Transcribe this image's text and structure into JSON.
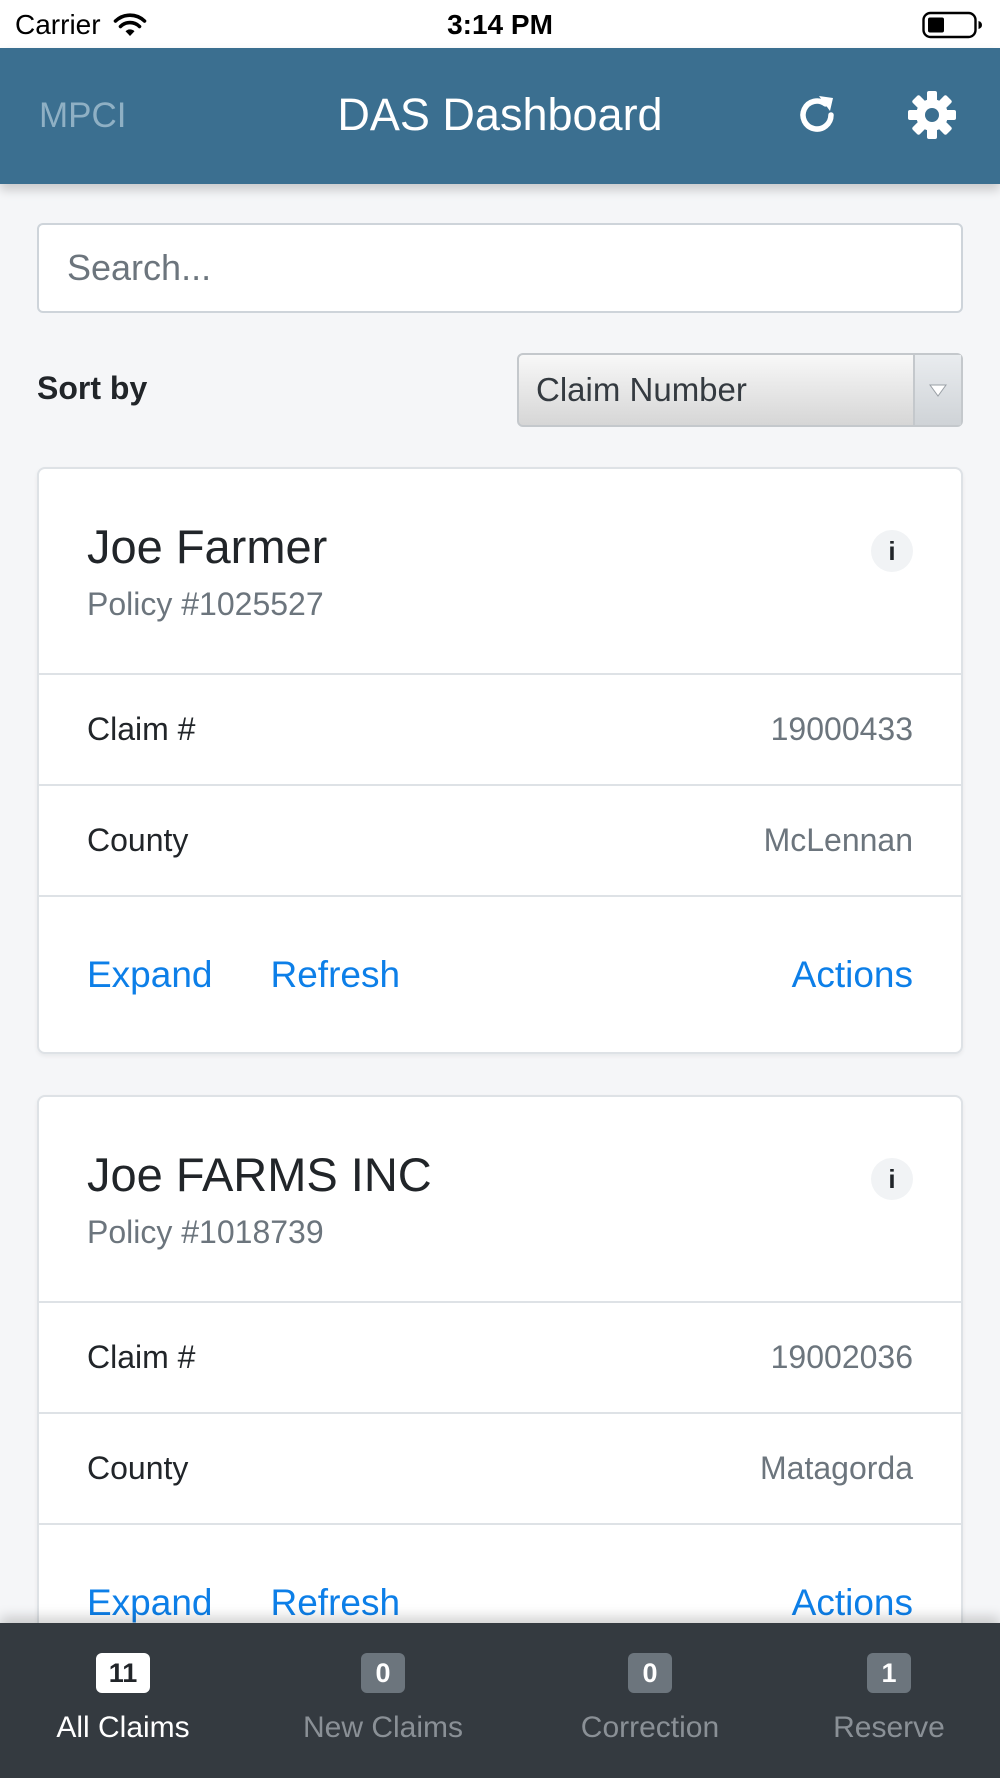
{
  "status_bar": {
    "carrier": "Carrier",
    "time": "3:14 PM"
  },
  "header": {
    "left_label": "MPCI",
    "title": "DAS Dashboard",
    "refresh_icon": "refresh-icon",
    "settings_icon": "gear-icon"
  },
  "search": {
    "placeholder": "Search...",
    "value": ""
  },
  "sort": {
    "label": "Sort by",
    "selected": "Claim Number"
  },
  "claims": [
    {
      "name": "Joe Farmer",
      "policy": "Policy #1025527",
      "claim_label": "Claim #",
      "claim_number": "19000433",
      "county_label": "County",
      "county": "McLennan",
      "expand": "Expand",
      "refresh": "Refresh",
      "actions": "Actions"
    },
    {
      "name": "Joe FARMS INC",
      "policy": "Policy #1018739",
      "claim_label": "Claim #",
      "claim_number": "19002036",
      "county_label": "County",
      "county": "Matagorda",
      "expand": "Expand",
      "refresh": "Refresh",
      "actions": "Actions"
    }
  ],
  "tabs": [
    {
      "label": "All Claims",
      "count": "11",
      "active": true
    },
    {
      "label": "New Claims",
      "count": "0",
      "active": false
    },
    {
      "label": "Correction",
      "count": "0",
      "active": false
    },
    {
      "label": "Reserve",
      "count": "1",
      "active": false
    }
  ],
  "colors": {
    "header_bg": "#3b6f90",
    "link": "#0d7fe8",
    "tab_bar_bg": "#343a40"
  }
}
